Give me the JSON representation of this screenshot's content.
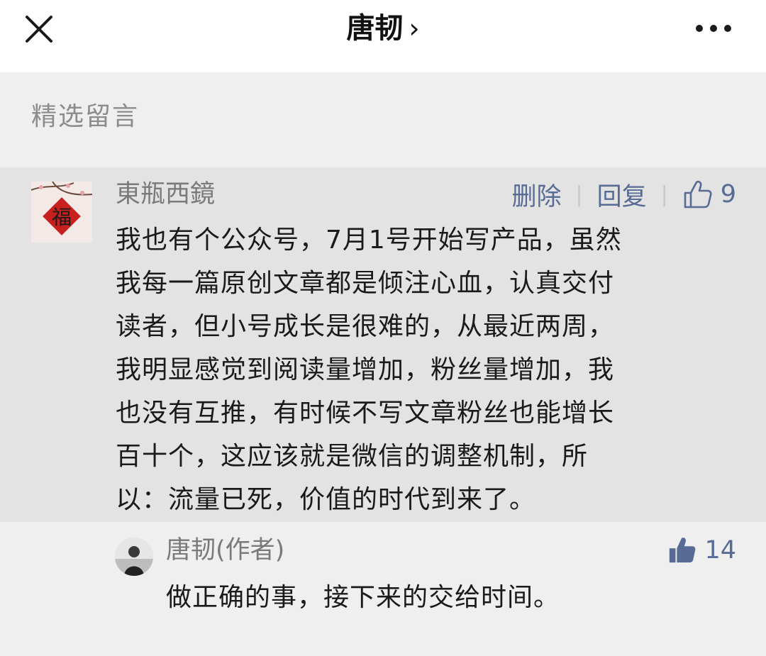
{
  "header": {
    "title": "唐韧",
    "chevron": "›",
    "close_icon": "close-icon",
    "more_icon": "more-icon"
  },
  "section": {
    "label": "精选留言"
  },
  "comment": {
    "author": "東瓶西鏡",
    "avatar_char": "福",
    "delete_label": "删除",
    "reply_label": "回复",
    "like_count": "9",
    "text": "我也有个公众号，7月1号开始写产品，虽然\n我每一篇原创文章都是倾注心血，认真交付\n读者，但小号成长是很难的，从最近两周，\n我明显感觉到阅读量增加，粉丝量增加，我\n也没有互推，有时候不写文章粉丝也能增长\n百十个，这应该就是微信的调整机制，所\n以：流量已死，价值的时代到来了。"
  },
  "reply": {
    "author": "唐韧(作者)",
    "like_count": "14",
    "text": "做正确的事，接下来的交给时间。"
  },
  "colors": {
    "link": "#576b95",
    "comment_bg": "#e3e3e3",
    "page_bg": "#efefef",
    "muted": "#8c8c8c"
  }
}
